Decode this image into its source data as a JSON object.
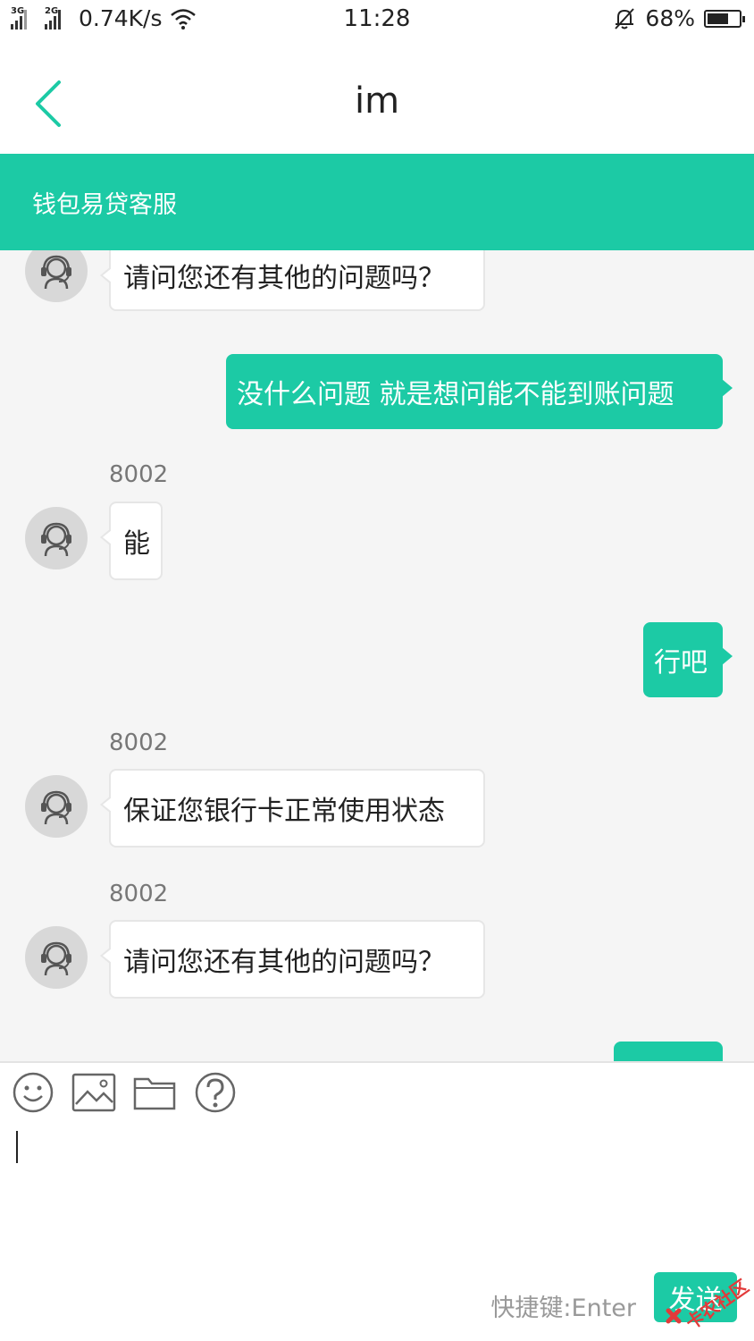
{
  "status_bar": {
    "sig1_label": "3G",
    "sig2_label": "2G",
    "speed": "0.74K/s",
    "time": "11:28",
    "battery_pct": "68%",
    "battery_level": 0.68
  },
  "nav": {
    "title": "im"
  },
  "service": {
    "name": "钱包易贷客服"
  },
  "messages": [
    {
      "dir": "in",
      "sender": "",
      "text": "请问您还有其他的问题吗？"
    },
    {
      "dir": "out",
      "text": "没什么问题 就是想问能不能到账问题"
    },
    {
      "dir": "in",
      "sender": "8002",
      "text": "能"
    },
    {
      "dir": "out",
      "text": "行吧"
    },
    {
      "dir": "in",
      "sender": "8002",
      "text": "保证您银行卡正常使用状态"
    },
    {
      "dir": "in",
      "sender": "8002",
      "text": "请问您还有其他的问题吗？"
    }
  ],
  "input": {
    "shortcut_hint": "快捷键:Enter",
    "send_label": "发送"
  },
  "watermark": {
    "text": "卡农社区"
  },
  "colors": {
    "accent": "#1ccaa5",
    "avatar_bg": "#d8d8d8"
  },
  "icons": [
    "back-arrow-icon",
    "emoji-icon",
    "image-icon",
    "folder-icon",
    "help-icon",
    "headset-agent-icon"
  ]
}
